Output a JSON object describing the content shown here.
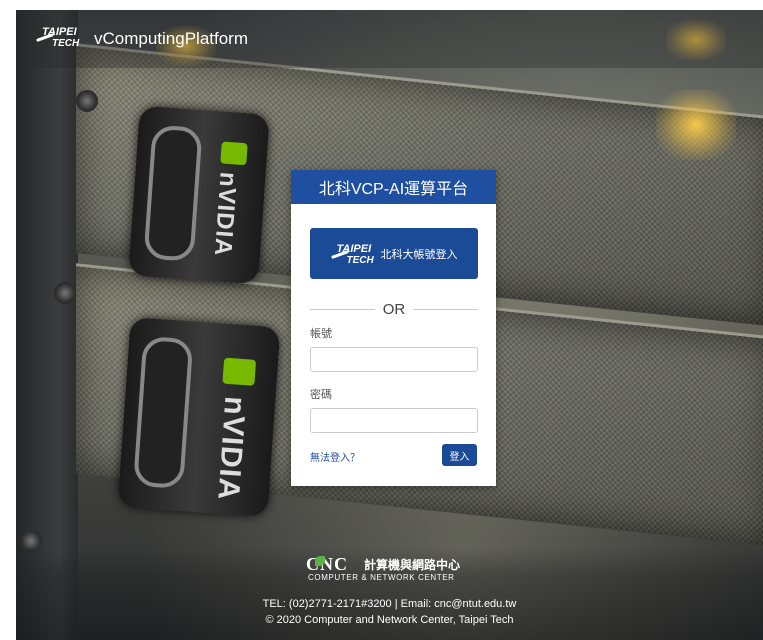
{
  "header": {
    "logo_line1": "TAIPEI",
    "logo_line2": "TECH",
    "app_title": "vComputingPlatform"
  },
  "background": {
    "brand_text_1": "nVIDIA",
    "brand_text_2": "nVIDIA"
  },
  "login": {
    "title": "北科VCP-AI運算平台",
    "sso_logo_line1": "TAIPEI",
    "sso_logo_line2": "TECH",
    "sso_label": "北科大帳號登入",
    "or_text": "OR",
    "account_label": "帳號",
    "account_value": "",
    "account_placeholder": "",
    "password_label": "密碼",
    "password_value": "",
    "password_placeholder": "",
    "forgot_link": "無法登入？",
    "login_button": "登入",
    "accent_color": "#1b4a96"
  },
  "footer": {
    "cnc_abbr": "CNC",
    "cnc_name_zh": "計算機與網路中心",
    "cnc_name_en": "COMPUTER & NETWORK CENTER",
    "contact": "TEL: (02)2771-2171#3200 | Email: cnc@ntut.edu.tw",
    "copyright": "© 2020 Computer and Network Center, Taipei Tech"
  }
}
